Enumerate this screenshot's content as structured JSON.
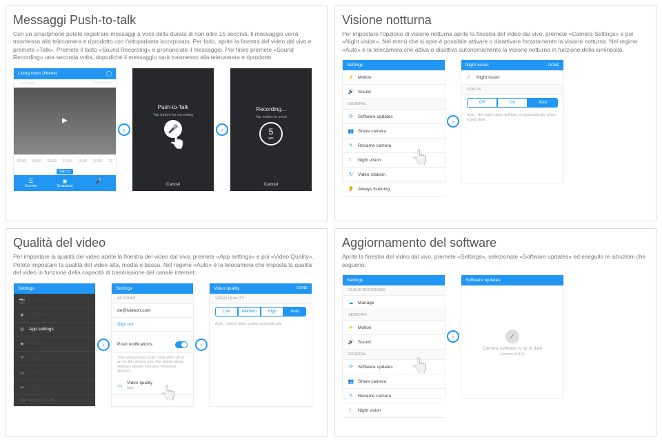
{
  "s1": {
    "title": "Messaggi Push-to-talk",
    "desc": "Con un smartphone potete registrare messaggi a voce della durata di non oltre 15 secondi, il messaggio verrà trasmesso alla telecamera e riprodotto con l'altoparlante incorporato. Per farlo, aprite la finestra del video dal vivo e premete «Talk». Premete il tasto «Sound Recording» e pronunciate il messaggio. Per finire premete «Sound Recording» una seconda volta, dopodiché il messaggio sarà trasmesso alla telecamera e riprodotto.",
    "cam_name": "Living room (Home)",
    "live_label": "Live (web)",
    "time": "4:50:57 PM",
    "date": "Sep 12",
    "ticks": [
      "02:00",
      "04:00",
      "08:00",
      "12:00",
      "16:00",
      "20:00",
      "29"
    ],
    "events": "Events",
    "snapshot": "Snapshot",
    "ptt_title": "Push-to-Talk",
    "ptt_sub": "Tap button for recording",
    "rec_title": "Recording...",
    "rec_sub": "Tap button to send",
    "sec": "sec",
    "count": "5",
    "cancel": "Cancel"
  },
  "s2": {
    "title": "Visione notturna",
    "desc": "Per impostare l'opzione di visione notturna aprite la finestra del video dal vivo, premete «Camera Settings» e poi «Night vision». Nel menù che si apre è possibile attivare o disattivare forzatamente la visione notturna. Nel regime «Auto» è la telecamera che attiva o disattiva autonomamente la visione notturna in funzione della luminosità.",
    "settings": "Settings",
    "nightvision": "Night vision",
    "done": "DONE",
    "items": [
      "Motion",
      "Sound",
      "Software updates",
      "Share camera",
      "Rename camera",
      "Night vision",
      "Video rotation",
      "Always listening"
    ],
    "general": "GENERAL",
    "status": "STATUS",
    "tabs": [
      "Off",
      "On",
      "Auto"
    ],
    "auto_note": "Auto - the night vision will turn on automatically when it gets dark."
  },
  "s3": {
    "title": "Qualità del video",
    "desc": "Per impostare la qualità del video aprite la finestra del video dal vivo, premete «App settings» e poi «Video Quality». Potete impostare la qualità del video alta, media e bassa. Nel regime «Auto» è la telecamera che imposta la qualità del video in funzione della capacità di trasmissione del canale internet.",
    "settings": "Settings",
    "vq": "Video quality",
    "done": "DONE",
    "menu": [
      "Cameras",
      "All events",
      "App settings",
      "Rate us",
      "Help",
      "Tutorial",
      "Sign out"
    ],
    "account": "ACCOUNT",
    "email": "de@ivideon.com",
    "signout": "Sign out",
    "push": "Push notifications",
    "push_note": "This setting turns push notification off or on for this device only. For global alerts settings, please visit your Personal account",
    "videoq": "Video quality",
    "vq_sub": "Auto",
    "vq_head": "VIDEO QUALITY",
    "tabs": [
      "Low",
      "Medium",
      "High",
      "Auto"
    ],
    "auto_note": "Auto - select video quality automatically",
    "version_note": "This setting turns push notification off or on for this device only. For global alerts settings, please visit",
    "app_ver": "App version 2.0.5.90"
  },
  "s4": {
    "title": "Aggiornamento del software",
    "desc": "Aprite la finestra del video dal vivo, premete «Settings», selezionate «Software updates» ed eseguite le istruzioni che seguono.",
    "settings": "Settings",
    "sw": "Software updates",
    "cloud": "CLOUD RECORDING",
    "manage": "Manage",
    "sensors": "SENSORS",
    "items": [
      "Motion",
      "Sound",
      "Software updates",
      "Share camera",
      "Rename camera",
      "Night vision"
    ],
    "general": "GENERAL",
    "uptodate": "Camera software is up to date",
    "ver": "(version 3.4.0)"
  }
}
